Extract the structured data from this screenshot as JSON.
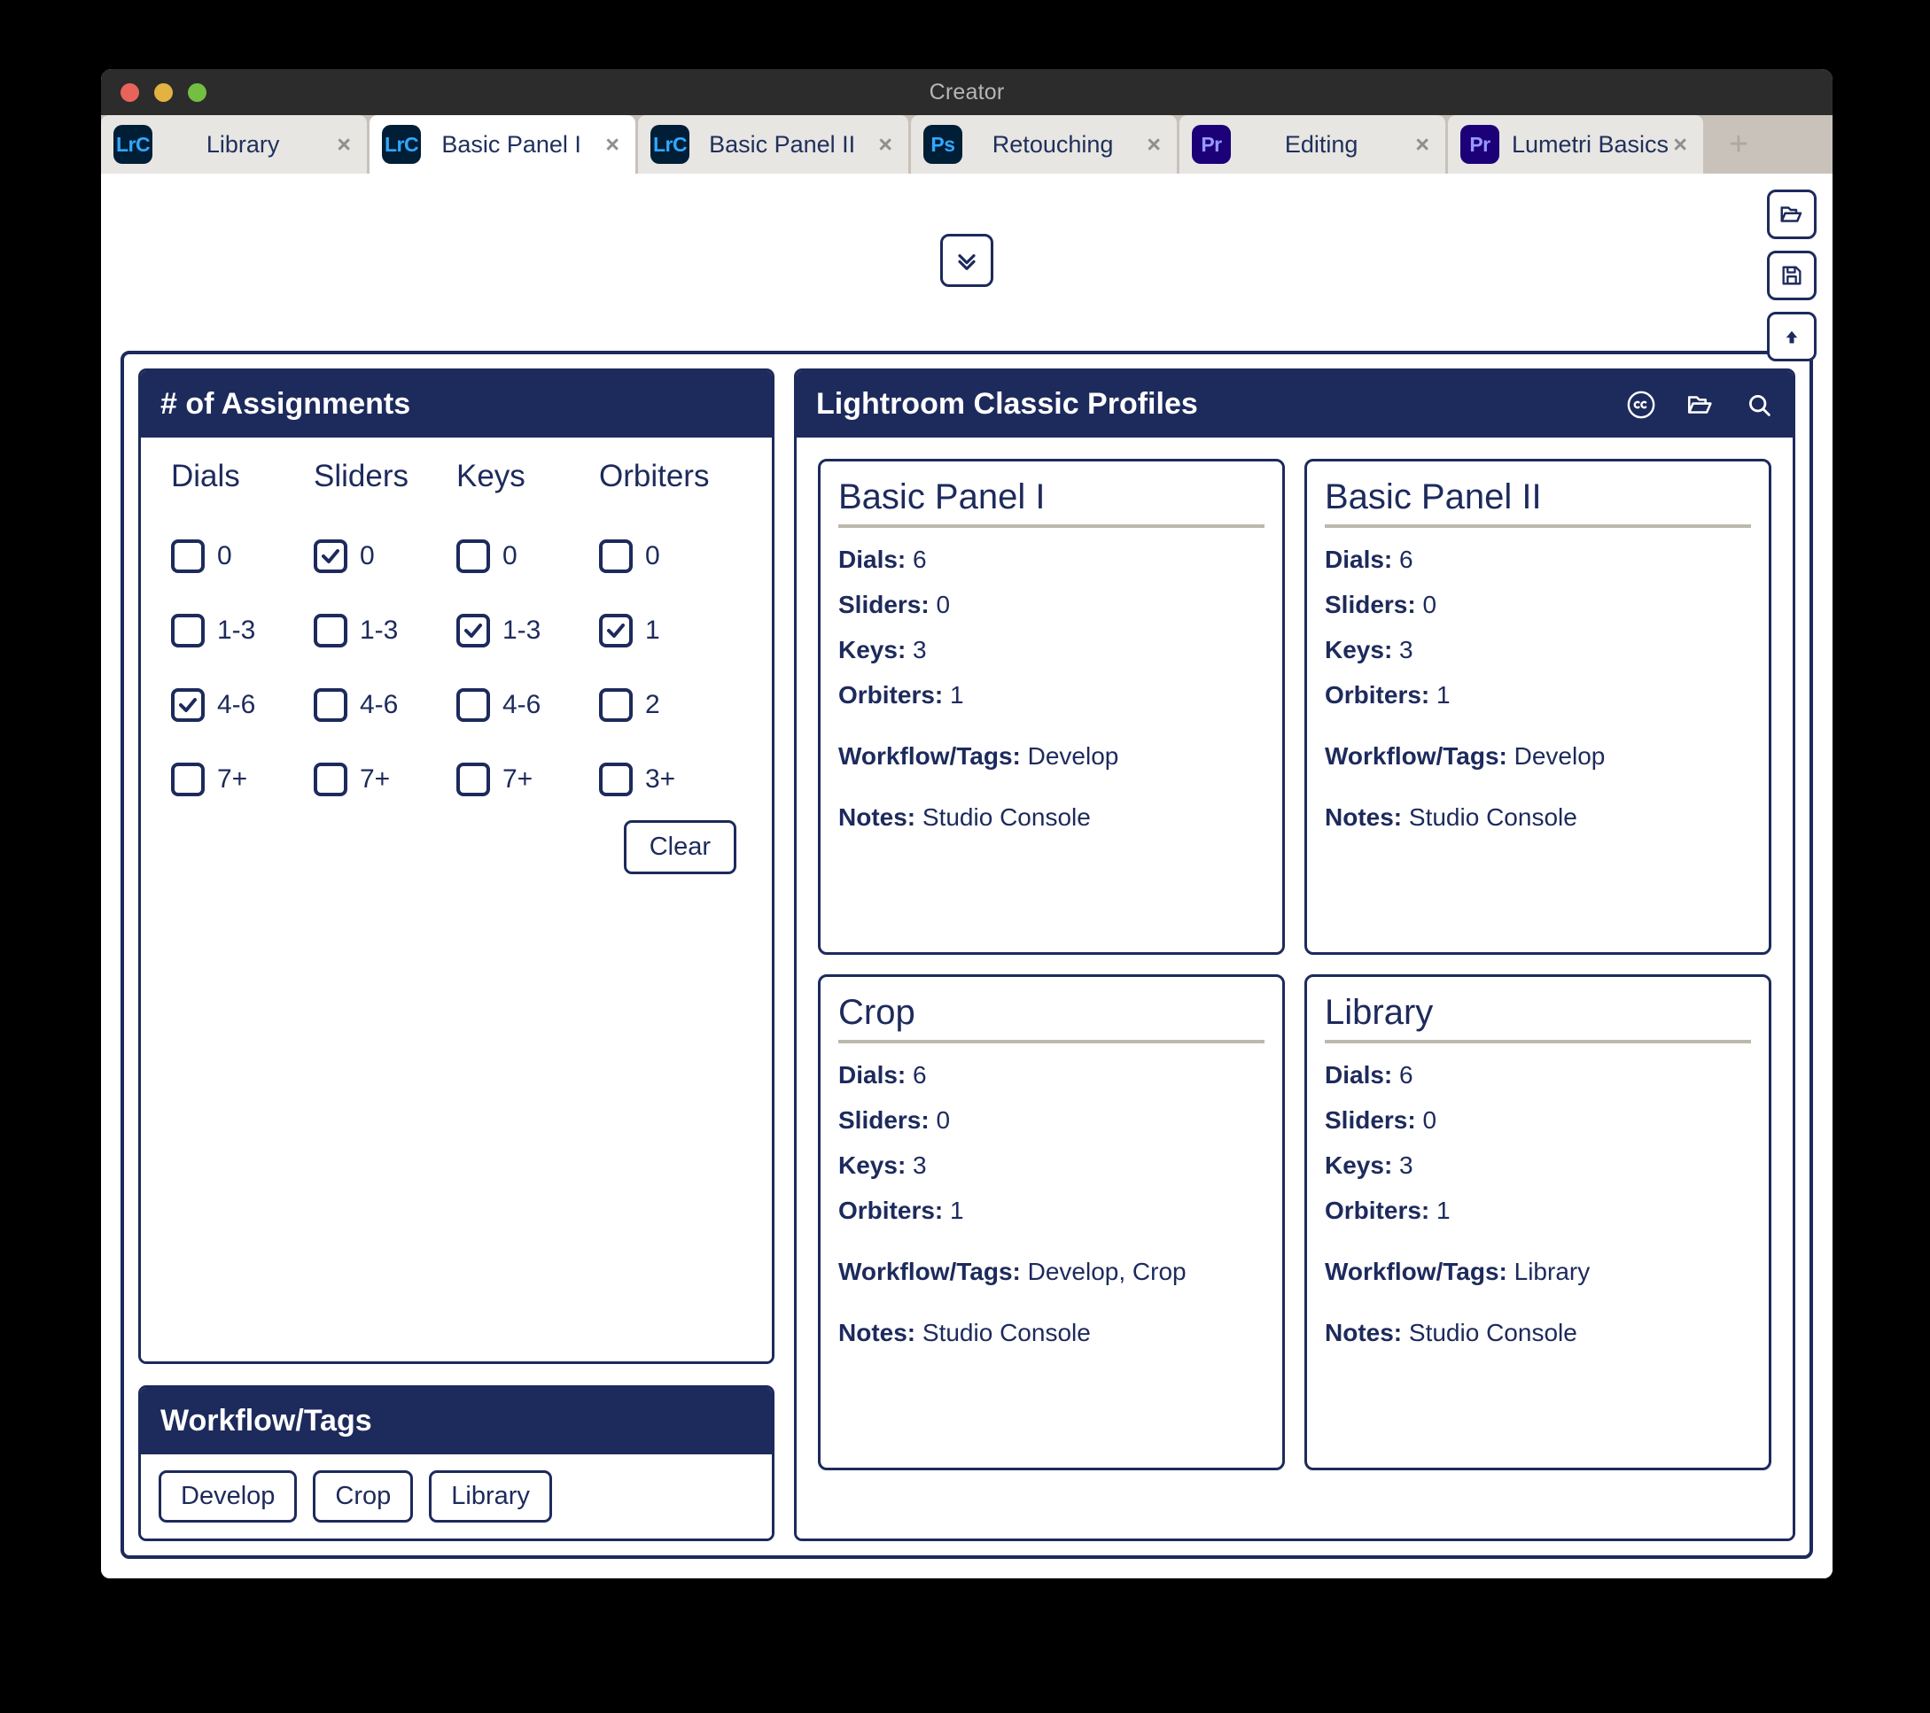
{
  "window": {
    "title": "Creator"
  },
  "tabs": [
    {
      "badge": "LrC",
      "badge_kind": "lrc",
      "label": "Library",
      "close": "×",
      "active": false
    },
    {
      "badge": "LrC",
      "badge_kind": "lrc",
      "label": "Basic Panel I",
      "close": "×",
      "active": true
    },
    {
      "badge": "LrC",
      "badge_kind": "lrc",
      "label": "Basic Panel II",
      "close": "×",
      "active": false
    },
    {
      "badge": "Ps",
      "badge_kind": "ps",
      "label": "Retouching",
      "close": "×",
      "active": false
    },
    {
      "badge": "Pr",
      "badge_kind": "pr",
      "label": "Editing",
      "close": "×",
      "active": false
    },
    {
      "badge": "Pr",
      "badge_kind": "pr",
      "label": "Lumetri Basics",
      "close": "×",
      "active": false
    }
  ],
  "tab_add_label": "+",
  "toolbar": {
    "open_icon": "open-folder-icon",
    "save_icon": "save-disk-icon",
    "third_icon": "cloud-upload-icon"
  },
  "collapse_button": {
    "icon": "chevron-double-down-icon"
  },
  "assignments": {
    "title": "# of Assignments",
    "columns": [
      {
        "name": "Dials",
        "options": [
          {
            "label": "0",
            "checked": false
          },
          {
            "label": "1-3",
            "checked": false
          },
          {
            "label": "4-6",
            "checked": true
          },
          {
            "label": "7+",
            "checked": false
          }
        ]
      },
      {
        "name": "Sliders",
        "options": [
          {
            "label": "0",
            "checked": true
          },
          {
            "label": "1-3",
            "checked": false
          },
          {
            "label": "4-6",
            "checked": false
          },
          {
            "label": "7+",
            "checked": false
          }
        ]
      },
      {
        "name": "Keys",
        "options": [
          {
            "label": "0",
            "checked": false
          },
          {
            "label": "1-3",
            "checked": true
          },
          {
            "label": "4-6",
            "checked": false
          },
          {
            "label": "7+",
            "checked": false
          }
        ]
      },
      {
        "name": "Orbiters",
        "options": [
          {
            "label": "0",
            "checked": false
          },
          {
            "label": "1",
            "checked": true
          },
          {
            "label": "2",
            "checked": false
          },
          {
            "label": "3+",
            "checked": false
          }
        ]
      }
    ],
    "clear_label": "Clear"
  },
  "workflow_tags": {
    "title": "Workflow/Tags",
    "chips": [
      "Develop",
      "Crop",
      "Library"
    ]
  },
  "profiles": {
    "title": "Lightroom Classic Profiles",
    "header_icons": [
      "creative-commons-icon",
      "open-folder-icon",
      "search-icon"
    ],
    "labels": {
      "dials": "Dials:",
      "sliders": "Sliders:",
      "keys": "Keys:",
      "orbiters": "Orbiters:",
      "workflow": "Workflow/Tags:",
      "notes": "Notes:"
    },
    "cards": [
      {
        "title": "Basic Panel I",
        "dials": "6",
        "sliders": "0",
        "keys": "3",
        "orbiters": "1",
        "workflow": "Develop",
        "notes": "Studio Console"
      },
      {
        "title": "Basic Panel II",
        "dials": "6",
        "sliders": "0",
        "keys": "3",
        "orbiters": "1",
        "workflow": "Develop",
        "notes": "Studio Console"
      },
      {
        "title": "Crop",
        "dials": "6",
        "sliders": "0",
        "keys": "3",
        "orbiters": "1",
        "workflow": "Develop, Crop",
        "notes": "Studio Console"
      },
      {
        "title": "Library",
        "dials": "6",
        "sliders": "0",
        "keys": "3",
        "orbiters": "1",
        "workflow": "Library",
        "notes": "Studio Console"
      }
    ]
  },
  "colors": {
    "navy": "#1d2a5c",
    "tab_active": "#ffffff",
    "tab_inactive": "#e8e6e2",
    "tabstrip": "#c9c2ba",
    "titlebar": "#2c2c2c"
  }
}
